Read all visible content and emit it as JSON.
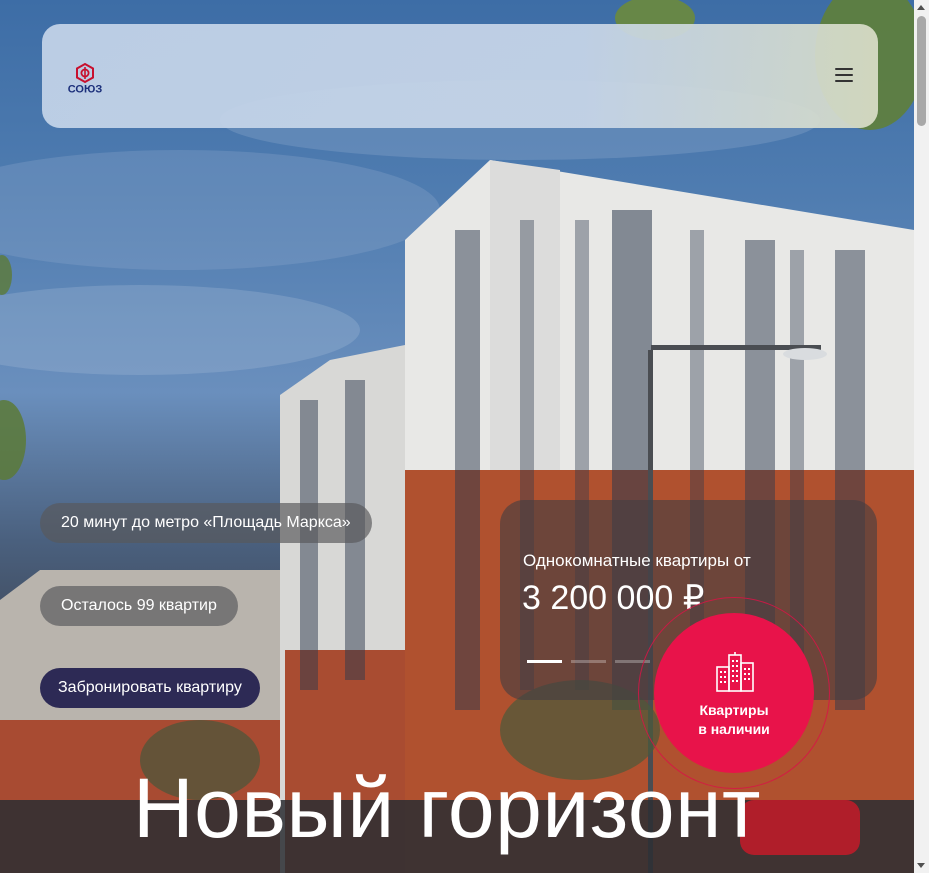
{
  "header": {
    "logo_text": "СОЮЗ",
    "menu_icon": "hamburger-menu-icon"
  },
  "hero": {
    "features": {
      "metro": "20 минут до метро «Площадь Маркса»",
      "apartments_left": "Осталось 99 квартир"
    },
    "book_button": "Забронировать квартиру",
    "offer": {
      "label": "Однокомнатные квартиры от",
      "price": "3 200 000 ₽",
      "slides_total": 3,
      "slide_active": 1
    },
    "cta": {
      "icon": "buildings-icon",
      "line1": "Квартиры",
      "line2": "в наличии"
    },
    "title": "Новый горизонт"
  },
  "colors": {
    "accent": "#e8134a",
    "book_button_bg": "#2d2a55",
    "logo_red": "#c8102e",
    "logo_blue": "#1b2f7a"
  }
}
